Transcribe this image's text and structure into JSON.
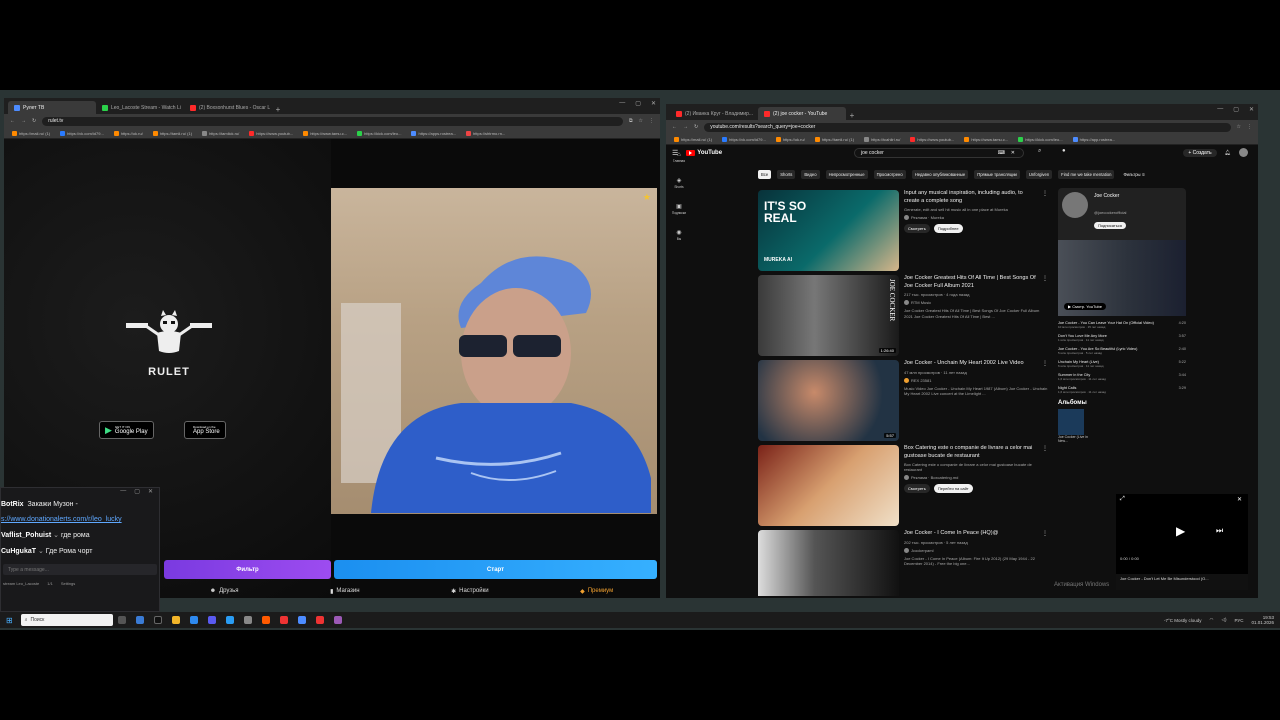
{
  "left_browser": {
    "tabs": [
      {
        "label": "Рулет ТВ",
        "color": "#4d8cff",
        "active": true
      },
      {
        "label": "Leo_Lacoste Stream - Watch Li",
        "color": "#2bd14a",
        "active": false
      },
      {
        "label": "(2) Boxsonhurst Blues - Oscar L",
        "color": "#ff2a2a",
        "active": false
      }
    ],
    "url": "rulet.tv",
    "bookmarks": [
      "https://mail.ru/ (1)",
      "https://vk.com/id79...",
      "https://ok.ru/",
      "https://tamli.ru/ (1)",
      "https://tamlick.ru/",
      "https://www.youtub...",
      "https://www.tamu.c...",
      "https://kick.com/leo...",
      "https://apps.rostrea...",
      "https://shtrmo.rn..."
    ],
    "app_name": "RULET",
    "google_play": "Google Play",
    "app_store": "App Store",
    "google_play_small": "GET IT ON",
    "app_store_small": "Download on the",
    "filter_btn": "Фильтр",
    "next_btn": "Старт",
    "nav": [
      "Друзья",
      "Магазин",
      "Настройки",
      "Премиум"
    ]
  },
  "chat": {
    "messages": [
      {
        "user": "BotRix",
        "text": "Закажи Музон -"
      },
      {
        "user": "",
        "link": "s://www.donationalerts.com/r/leo_lucky"
      },
      {
        "user": "Vaflist_Pohuist",
        "text": "где рома"
      },
      {
        "user": "CuHgukaT",
        "text": "Где Рома чорт"
      }
    ],
    "input_placeholder": "Type a message...",
    "footer": "stream Leo_Lacoste",
    "footer_count": "1/1",
    "footer_settings": "Settings"
  },
  "right_browser": {
    "tabs": [
      {
        "label": "(2) Иванка Круг - Владимир...",
        "color": "#ff2a2a"
      },
      {
        "label": "(2) joe cocker - YouTube",
        "color": "#ff2a2a"
      }
    ],
    "url": "youtube.com/results?search_query=joe+cocker",
    "bookmarks": [
      "https://mail.ru/ (1)",
      "https://vk.com/id79...",
      "https://ok.ru/",
      "https://tamli.ru/ (1)",
      "https://tcahliri.ru/",
      "https://www.youtub...",
      "https://www.tamu.c...",
      "https://kick.com/leo...",
      "https://app.rostrea..."
    ],
    "logo": "YouTube",
    "search_value": "joe cocker",
    "create": "Создать",
    "chips": [
      "Все",
      "Shorts",
      "Видео",
      "Непросмотренные",
      "Просмотрено",
      "Недавно опубликованные",
      "Прямые трансляции",
      "Unforgiven",
      "Find me we take mentation"
    ],
    "filters": "Фильтры",
    "side": [
      "Главная",
      "Shorts",
      "Подписки",
      "Вы"
    ],
    "results": [
      {
        "title": "Input any musical inspiration, including audio, to create a complete song",
        "meta": "Generate, edit and sell hit music all in one place at Mureka",
        "channel": "Реклама · Mureka",
        "actions": [
          "Смотреть",
          "Подробнее"
        ],
        "thumb_text": "IT'S SO REAL",
        "thumb_brand": "MUREKA AI"
      },
      {
        "title": "Joe Cocker Greatest Hits Of All Time | Best Songs Of Joe Cocker Full Album 2021",
        "meta": "217 тыс. просмотров · 4 года назад",
        "channel": "RTM Music",
        "desc": "Joe Cocker Greatest Hits Of All Time | Best Songs Of Joe Cocker Full Album 2021 Joe Cocker Greatest Hits Of All Time | Best ...",
        "duration": "1:26:40",
        "thumb_text": "JOE COCKER"
      },
      {
        "title": "Joe Cocker - Unchain My Heart 2002 Live Video",
        "meta": "47 млн просмотров · 11 лет назад",
        "channel": "REX 23581",
        "desc": "Music Video Joe Cocker - Unchain My Heart 1987 (Album) Joe Cocker - Unchain My Heart 2002 Live concert at the Limelight ...",
        "duration": "5:57"
      },
      {
        "title": "Box Catering este o companie de livrare a celor mai gustoase bucate de restaurant",
        "meta": "Box Catering este o companie de livrare a celor mai gustoase bucate de restaurant",
        "channel": "Реклама · Boxcatering.md",
        "actions": [
          "Смотреть",
          "Перейти на сайт"
        ]
      },
      {
        "title": "Joe Cocker - I Come In Peace (HQ)@",
        "meta": "202 тыс. просмотров · 5 лет назад",
        "channel": "Jcockerpaml",
        "desc": "Joe Cocker - I Come In Peace (Album: Fire It Up 2012) (29 May 1944 - 22 December 2014) - Free the big one..."
      }
    ],
    "channel_card": {
      "name": "Joe Cocker",
      "handle": "@joecockerofficial",
      "subscribe": "Подписаться",
      "watch_youtube": "Смотр. YouTube",
      "songs": [
        {
          "title": "Joe Cocker - You Can Leave Your Hat On (Official Video)",
          "meta": "10 млн просмотров · 15 лет назад",
          "time": "4:20"
        },
        {
          "title": "Don't You Love Me Any More",
          "meta": "1 млн просмотров · 11 лет назад",
          "time": "3:57"
        },
        {
          "title": "Joe Cocker - You Are So Beautiful (Lyric Video)",
          "meta": "5 млн просмотров · 5 лет назад",
          "time": "2:40"
        },
        {
          "title": "Unchain My Heart (Live)",
          "meta": "6 млн просмотров · 11 лет назад",
          "time": "5:22"
        },
        {
          "title": "Summer in the City",
          "meta": "1,6 млн просмотров · 11 лет назад",
          "time": "3:44"
        },
        {
          "title": "Night Calls",
          "meta": "1,6 млн просмотров · 11 лет назад",
          "time": "3:29"
        }
      ],
      "albums_label": "Альбомы",
      "album_name": "Joe Cocker (Live in New..."
    },
    "mini_player": {
      "time": "0:00 / 0:00",
      "title": "Joe Cocker - Don't Let Me Be Misunderstood (O..."
    },
    "watermark": "Активация Windows"
  },
  "taskbar": {
    "search": "Поиск",
    "weather": "-7°C  Mostly cloudy",
    "lang": "РУС",
    "time": "19:53",
    "date": "01.01.2026"
  }
}
